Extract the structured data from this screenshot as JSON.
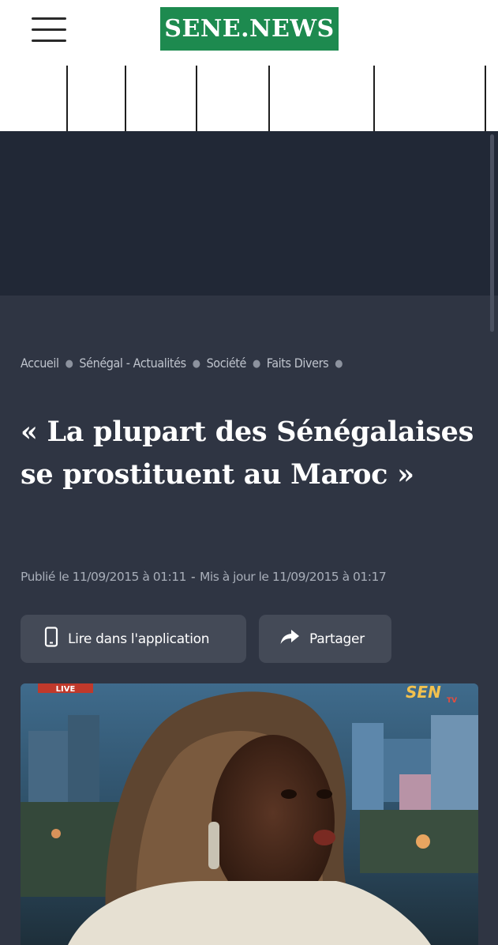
{
  "header": {
    "menu_icon": "hamburger-menu-icon",
    "logo_text": "SENE.NEWS"
  },
  "colors": {
    "brand_green": "#1d8a4f",
    "page_bg": "#2f3543",
    "ad_bg": "#212836",
    "button_bg": "#444a57"
  },
  "breadcrumb": [
    {
      "label": "Accueil"
    },
    {
      "label": "Sénégal - Actualités"
    },
    {
      "label": "Société"
    },
    {
      "label": "Faits Divers"
    }
  ],
  "article": {
    "title": "« La plupart des Sénégalaises se prostituent au Maroc »",
    "published": "Publié le 11/09/2015 à 01:11",
    "separator": "-",
    "updated": "Mis à jour le 11/09/2015 à 01:17"
  },
  "actions": {
    "read_in_app": {
      "label": "Lire dans l'application",
      "icon": "smartphone-icon"
    },
    "share": {
      "label": "Partager",
      "icon": "share-arrow-icon"
    }
  },
  "hero_image": {
    "live_badge": "LIVE",
    "channel_logo": "SEN",
    "channel_logo_sub": "TV"
  }
}
